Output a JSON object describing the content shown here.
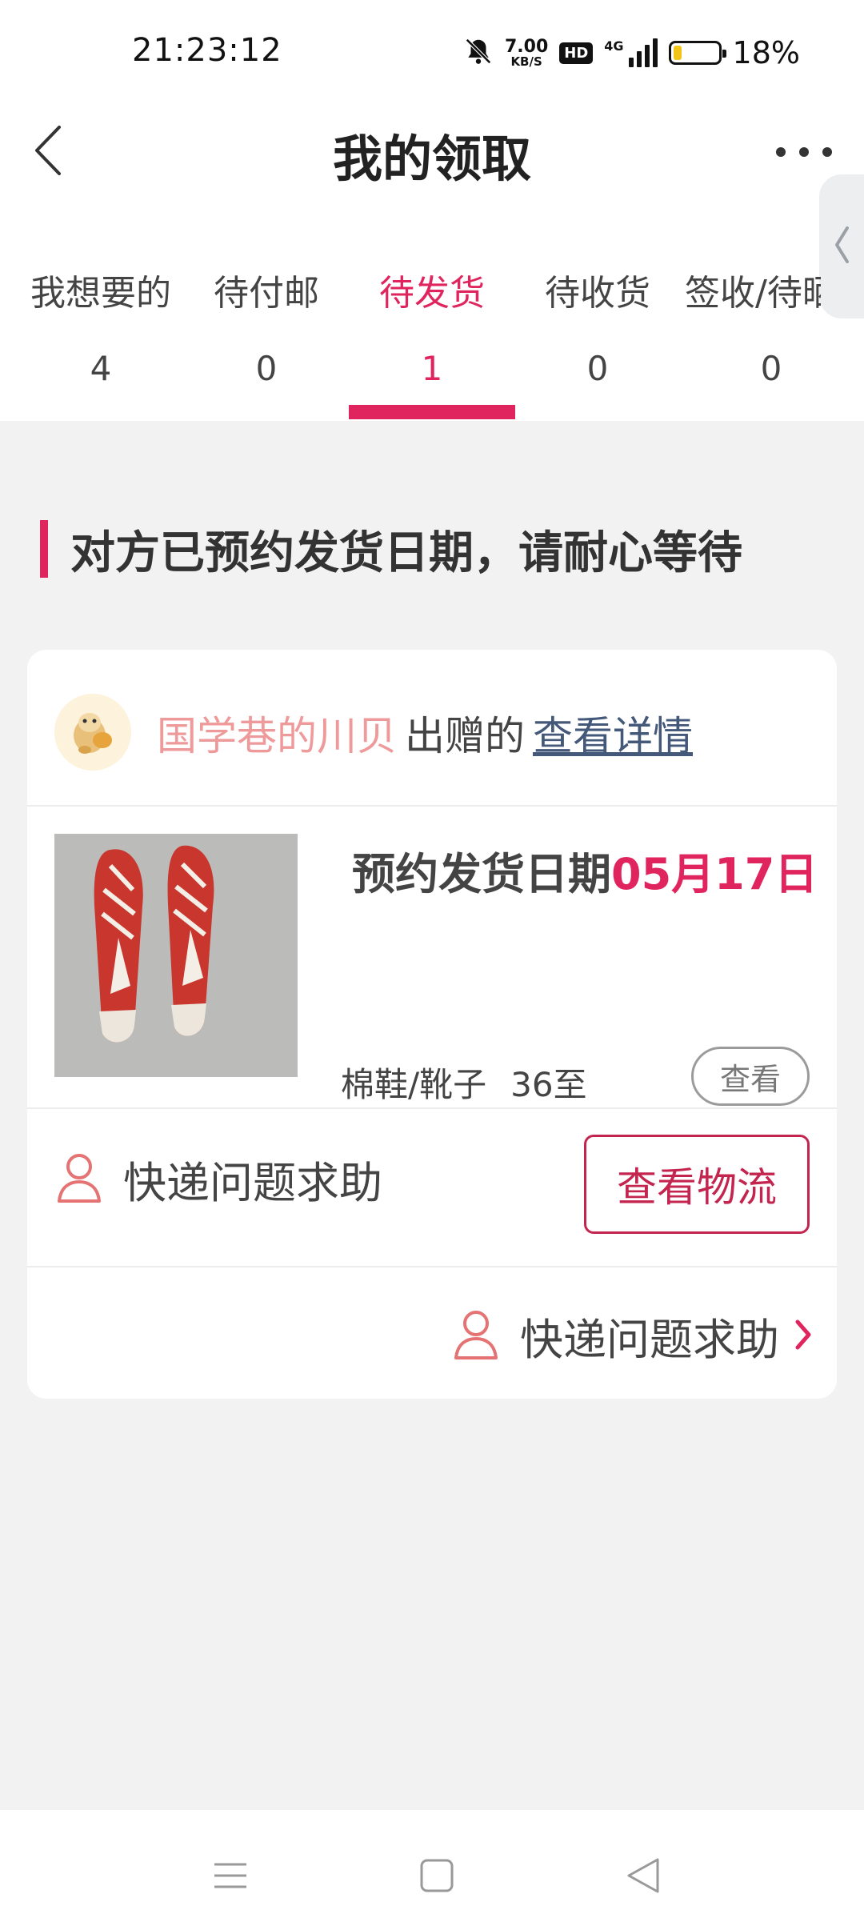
{
  "status_bar": {
    "time": "21:23:12",
    "net_speed": "7.00",
    "net_speed_unit": "KB/S",
    "hd_label": "HD",
    "network_type": "4G",
    "battery_percent": "18%",
    "battery_level": 0.18,
    "icons": [
      "bell-muted-icon",
      "signal-icon",
      "battery-icon"
    ]
  },
  "header": {
    "title": "我的领取",
    "icons": [
      "back-arrow-icon",
      "more-icon",
      "side-panel-chevron-icon"
    ]
  },
  "tabs": [
    {
      "label": "我想要的",
      "count": "4"
    },
    {
      "label": "待付邮",
      "count": "0"
    },
    {
      "label": "待发货",
      "count": "1",
      "active": true
    },
    {
      "label": "待收货",
      "count": "0"
    },
    {
      "label": "签收/待晒",
      "count": "0"
    }
  ],
  "colors": {
    "accent": "#e0245e",
    "giver_name": "#ef9a9a",
    "link": "#44587a",
    "logistics_border": "#c4254f",
    "background": "#f2f2f2"
  },
  "notice": {
    "text": "对方已预约发货日期，请耐心等待"
  },
  "card": {
    "giver_name": "国学巷的川贝",
    "giver_verb": "出赠的",
    "detail_link": "查看详情",
    "ship_date_label": "预约发货日期",
    "ship_date_value": "05月17日",
    "category": "棉鞋/靴子",
    "size": "36至",
    "view_button": "查看",
    "help_text": "快递问题求助",
    "logistics_button": "查看物流",
    "help_text_2": "快递问题求助"
  },
  "bottom_nav": {
    "icons": [
      "menu-icon",
      "home-square-icon",
      "back-triangle-icon"
    ]
  }
}
